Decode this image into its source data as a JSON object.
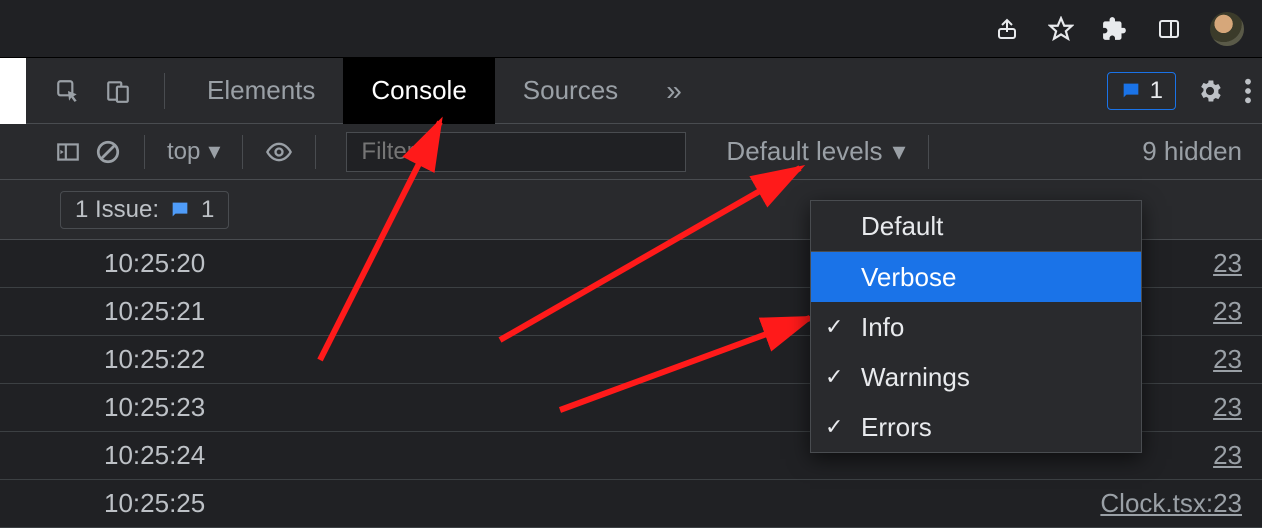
{
  "chrome": {},
  "devtools": {
    "tabs": {
      "elements": "Elements",
      "console": "Console",
      "sources": "Sources"
    },
    "issues_badge": "1"
  },
  "toolbar": {
    "context": "top",
    "filter_placeholder": "Filter",
    "levels_label": "Default levels",
    "hidden_count": "9 hidden"
  },
  "issue_row": {
    "label": "1 Issue:",
    "count": "1"
  },
  "messages": [
    {
      "time": "10:25:20",
      "src": "23"
    },
    {
      "time": "10:25:21",
      "src": "23"
    },
    {
      "time": "10:25:22",
      "src": "23"
    },
    {
      "time": "10:25:23",
      "src": "23"
    },
    {
      "time": "10:25:24",
      "src": "23"
    },
    {
      "time": "10:25:25",
      "src": "Clock.tsx:23"
    }
  ],
  "levels_popup": {
    "items": [
      {
        "label": "Default",
        "checked": false,
        "highlight": false
      },
      {
        "label": "Verbose",
        "checked": false,
        "highlight": true
      },
      {
        "label": "Info",
        "checked": true,
        "highlight": false
      },
      {
        "label": "Warnings",
        "checked": true,
        "highlight": false
      },
      {
        "label": "Errors",
        "checked": true,
        "highlight": false
      }
    ]
  }
}
